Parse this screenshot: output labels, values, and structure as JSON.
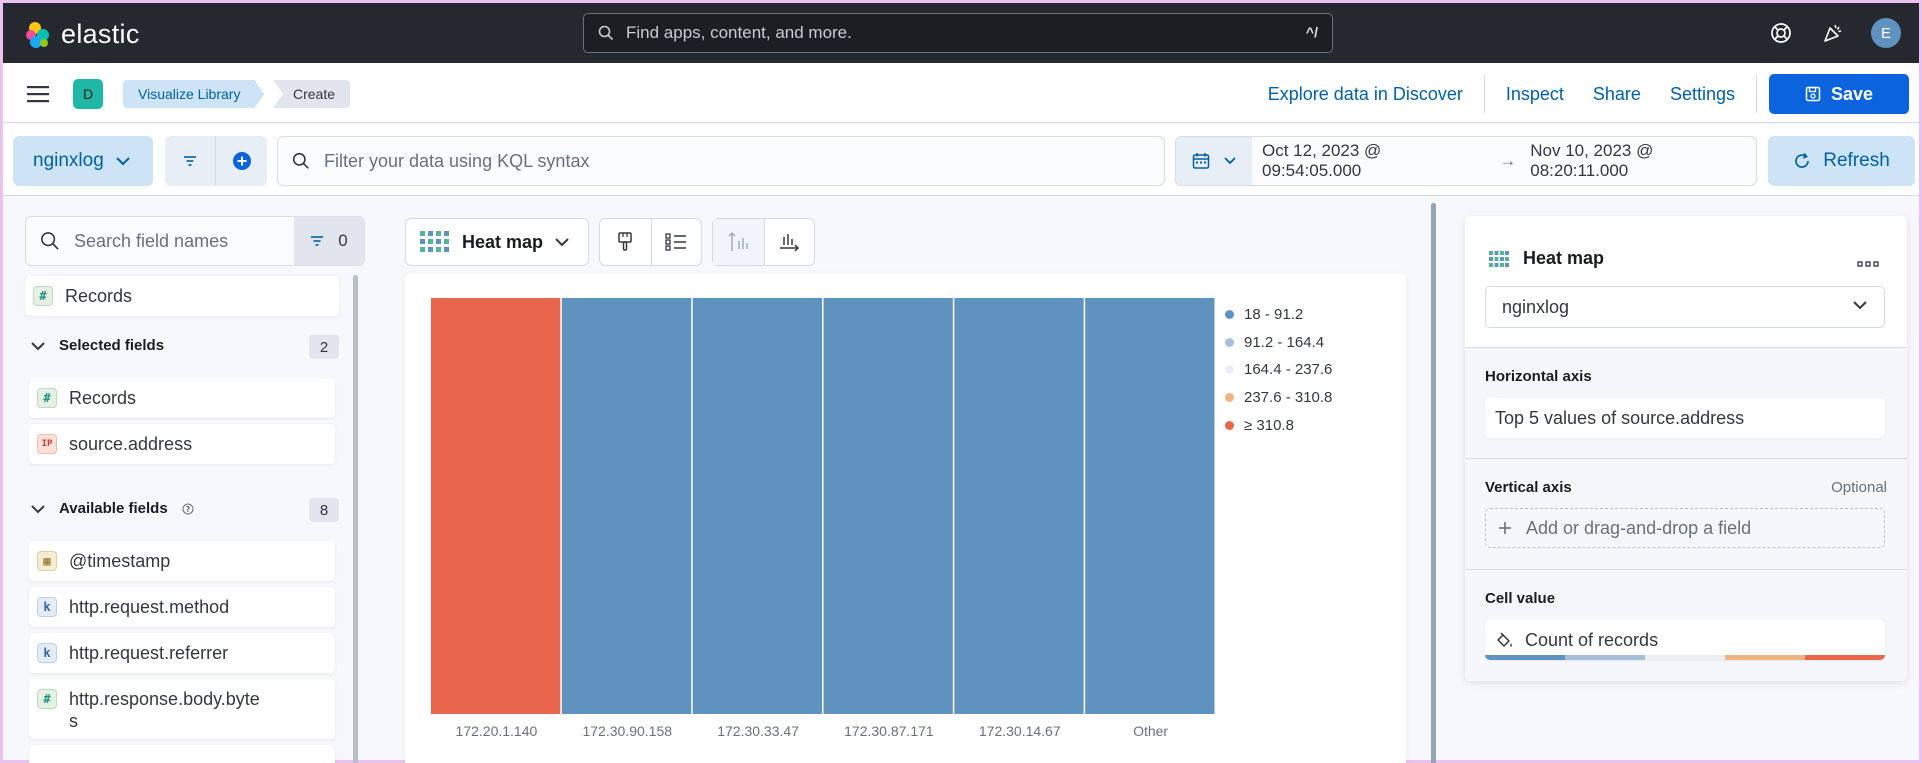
{
  "app": {
    "brand": "elastic",
    "avatar_letter": "E"
  },
  "global_search": {
    "placeholder": "Find apps, content, and more.",
    "shortcut": "^/"
  },
  "breadcrumbs": {
    "space_letter": "D",
    "items": [
      "Visualize Library",
      "Create"
    ]
  },
  "nav": {
    "explore": "Explore data in Discover",
    "inspect": "Inspect",
    "share": "Share",
    "settings": "Settings",
    "save": "Save"
  },
  "query": {
    "data_view": "nginxlog",
    "placeholder": "Filter your data using KQL syntax",
    "date_start": "Oct 12, 2023 @ 09:54:05.000",
    "date_arrow": "→",
    "date_end": "Nov 10, 2023 @ 08:20:11.000",
    "refresh": "Refresh"
  },
  "fields": {
    "search_placeholder": "Search field names",
    "filter_count": "0",
    "records": "Records",
    "selected_label": "Selected fields",
    "selected_count": "2",
    "selected": [
      {
        "type": "number",
        "token": "#",
        "name": "Records"
      },
      {
        "type": "ip",
        "token": "IP",
        "name": "source.address"
      }
    ],
    "available_label": "Available fields",
    "available_count": "8",
    "available": [
      {
        "type": "date",
        "token": "▦",
        "name": "@timestamp"
      },
      {
        "type": "keyword",
        "token": "k",
        "name": "http.request.method"
      },
      {
        "type": "keyword",
        "token": "k",
        "name": "http.request.referrer"
      },
      {
        "type": "number",
        "token": "#",
        "name": "http.response.body.byte\ns"
      }
    ]
  },
  "workspace": {
    "chart_type_label": "Heat map"
  },
  "chart_data": {
    "type": "heatmap",
    "categories": [
      "172.20.1.140",
      "172.30.90.158",
      "172.30.33.47",
      "172.30.87.171",
      "172.30.14.67",
      "Other"
    ],
    "values": [
      400,
      20,
      20,
      20,
      20,
      20
    ],
    "legend": [
      {
        "label": "18 - 91.2",
        "color": "#6092c0"
      },
      {
        "label": "91.2 - 164.4",
        "color": "#a8bfda"
      },
      {
        "label": "164.4 - 237.6",
        "color": "#ebeff5"
      },
      {
        "label": "237.6 - 310.8",
        "color": "#ecb385"
      },
      {
        "label": "≥ 310.8",
        "color": "#e7664c"
      }
    ],
    "cell_colors": [
      "#e7664c",
      "#6092c0",
      "#6092c0",
      "#6092c0",
      "#6092c0",
      "#6092c0"
    ]
  },
  "config": {
    "title": "Heat map",
    "layer": "nginxlog",
    "horizontal_label": "Horizontal axis",
    "horizontal_value": "Top 5 values of source.address",
    "vertical_label": "Vertical axis",
    "vertical_optional": "Optional",
    "vertical_placeholder": "Add or drag-and-drop a field",
    "cell_label": "Cell value",
    "cell_value": "Count of records"
  },
  "colors": {
    "accent": "#0b64dd",
    "header": "#25282f",
    "link": "#0061a6"
  }
}
